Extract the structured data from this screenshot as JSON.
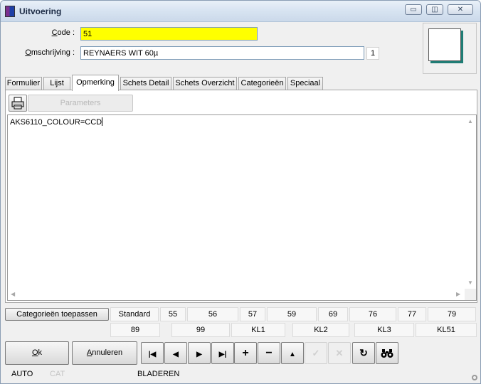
{
  "window": {
    "title": "Uitvoering",
    "minimize_glyph": "▭",
    "maximize_glyph": "◫",
    "close_glyph": "✕"
  },
  "form": {
    "code_label_prefix": "C",
    "code_label_rest": "ode :",
    "code_value": "51",
    "description_label_prefix": "O",
    "description_label_rest": "mschrijving :",
    "description_value": "REYNAERS WIT 60µ",
    "description_count": "1",
    "code_bg_color": "#ffff00",
    "preview_shadow_color": "#1f7c74"
  },
  "tabs": [
    {
      "label": "Formulier"
    },
    {
      "label": "Lijst"
    },
    {
      "label": "Opmerking"
    },
    {
      "label": "Schets Detail"
    },
    {
      "label": "Schets Overzicht"
    },
    {
      "label": "Categorieën"
    },
    {
      "label": "Speciaal"
    }
  ],
  "active_tab": "Opmerking",
  "panel": {
    "print_icon": "printer-icon",
    "params_label": "Parameters",
    "memo_text": "AKS6110_COLOUR=CCD"
  },
  "categories": {
    "apply_label": "Categorieën toepassen",
    "row1": [
      "Standard",
      "55",
      "56",
      "57",
      "59",
      "69",
      "76",
      "77",
      "79"
    ],
    "row2": [
      "89",
      "99",
      "KL1",
      "KL2",
      "KL3",
      "KL51"
    ]
  },
  "buttons": {
    "ok_prefix": "O",
    "ok_rest": "k",
    "cancel_prefix": "A",
    "cancel_rest": "nnuleren"
  },
  "nav_buttons": [
    {
      "name": "first-record-icon",
      "glyph": "|◀"
    },
    {
      "name": "prev-record-icon",
      "glyph": "◀"
    },
    {
      "name": "next-record-icon",
      "glyph": "▶"
    },
    {
      "name": "last-record-icon",
      "glyph": "▶|"
    },
    {
      "name": "add-record-icon",
      "glyph": "+"
    },
    {
      "name": "delete-record-icon",
      "glyph": "−"
    },
    {
      "name": "edit-record-icon",
      "glyph": "▲"
    },
    {
      "name": "confirm-icon",
      "glyph": "✓"
    },
    {
      "name": "cancel-edit-icon",
      "glyph": "✕"
    },
    {
      "name": "refresh-icon",
      "glyph": "↻"
    },
    {
      "name": "binoculars-icon",
      "glyph": "🔭"
    }
  ],
  "status": {
    "mode": "AUTO",
    "cat": "CAT",
    "state": "BLADEREN"
  }
}
